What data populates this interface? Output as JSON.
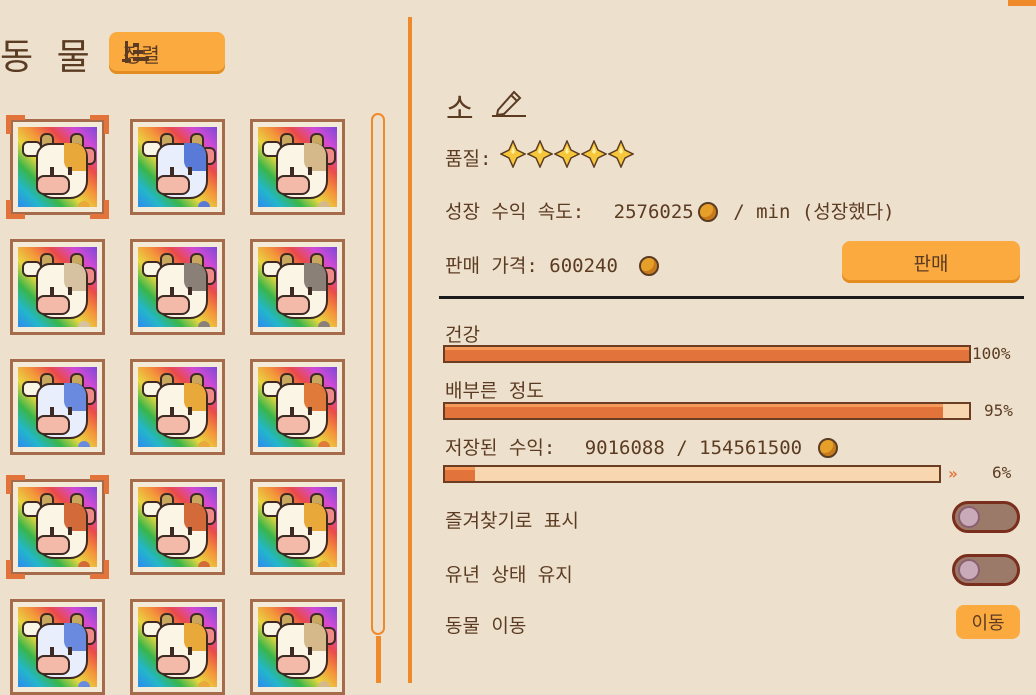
{
  "panel_title": "동 물",
  "sort_label": "정렬",
  "animal": {
    "name": "소",
    "quality_label": "품질:",
    "quality_stars": 5,
    "growth_label": "성장 수익 속도:",
    "growth_value": "2576025",
    "growth_unit": "/ min (성장했다)",
    "price_label": "판매 가격:",
    "price_value": "600240",
    "sell_label": "판매"
  },
  "stats": {
    "health_label": "건강",
    "health_pct": 100,
    "health_text": "100%",
    "full_label": "배부른 정도",
    "full_pct": 95,
    "full_text": "95%",
    "stored_label": "저장된 수익:",
    "stored_value": "9016088 / 154561500",
    "stored_pct": 6,
    "stored_text": "6%",
    "stored_chevron": "»"
  },
  "options": {
    "favorite_label": "즐겨찾기로 표시",
    "favorite_on": false,
    "youth_label": "유년 상태 유지",
    "youth_on": false,
    "move_label": "동물 이동",
    "move_button": "이동"
  },
  "cows": [
    {
      "patch": "#e8a83a",
      "spot": "#e8a83a",
      "face": "#fbf5e6",
      "selected": true
    },
    {
      "patch": "#5a7ad8",
      "spot": "#5a7ad8",
      "face": "#e8eefb",
      "selected": false
    },
    {
      "patch": "#d6b98a",
      "spot": "#d6b98a",
      "face": "#fbf5e6",
      "selected": false
    },
    {
      "patch": "#d6c1a0",
      "spot": "#d6c1a0",
      "face": "#fbf5e6",
      "selected": false
    },
    {
      "patch": "#8a8078",
      "spot": "#8a8078",
      "face": "#fbf5e6",
      "selected": false
    },
    {
      "patch": "#8a8078",
      "spot": "#8a8078",
      "face": "#fbf5e6",
      "selected": false
    },
    {
      "patch": "#6a8ae0",
      "spot": "#6a8ae0",
      "face": "#e8eefb",
      "selected": false
    },
    {
      "patch": "#e8a83a",
      "spot": "#e8a83a",
      "face": "#fbf5e6",
      "selected": false
    },
    {
      "patch": "#e07a3a",
      "spot": "#e07a3a",
      "face": "#fbf5e6",
      "selected": false
    },
    {
      "patch": "#d26a3a",
      "spot": "#d26a3a",
      "face": "#fbf5e6",
      "selected": true
    },
    {
      "patch": "#d26a3a",
      "spot": "#d26a3a",
      "face": "#fbf5e6",
      "selected": false
    },
    {
      "patch": "#e8a83a",
      "spot": "#e8a83a",
      "face": "#fbf5e6",
      "selected": false
    },
    {
      "patch": "#6a8ae0",
      "spot": "#6a8ae0",
      "face": "#e8eefb",
      "selected": false
    },
    {
      "patch": "#e8a83a",
      "spot": "#e8a83a",
      "face": "#fbf5e6",
      "selected": false
    },
    {
      "patch": "#d6b98a",
      "spot": "#d6b98a",
      "face": "#fbf5e6",
      "selected": false
    }
  ],
  "colors": {
    "accent": "#fbaa40",
    "bar": "#e2733a",
    "frame": "#a56b4a",
    "background": "#ede1cd"
  }
}
